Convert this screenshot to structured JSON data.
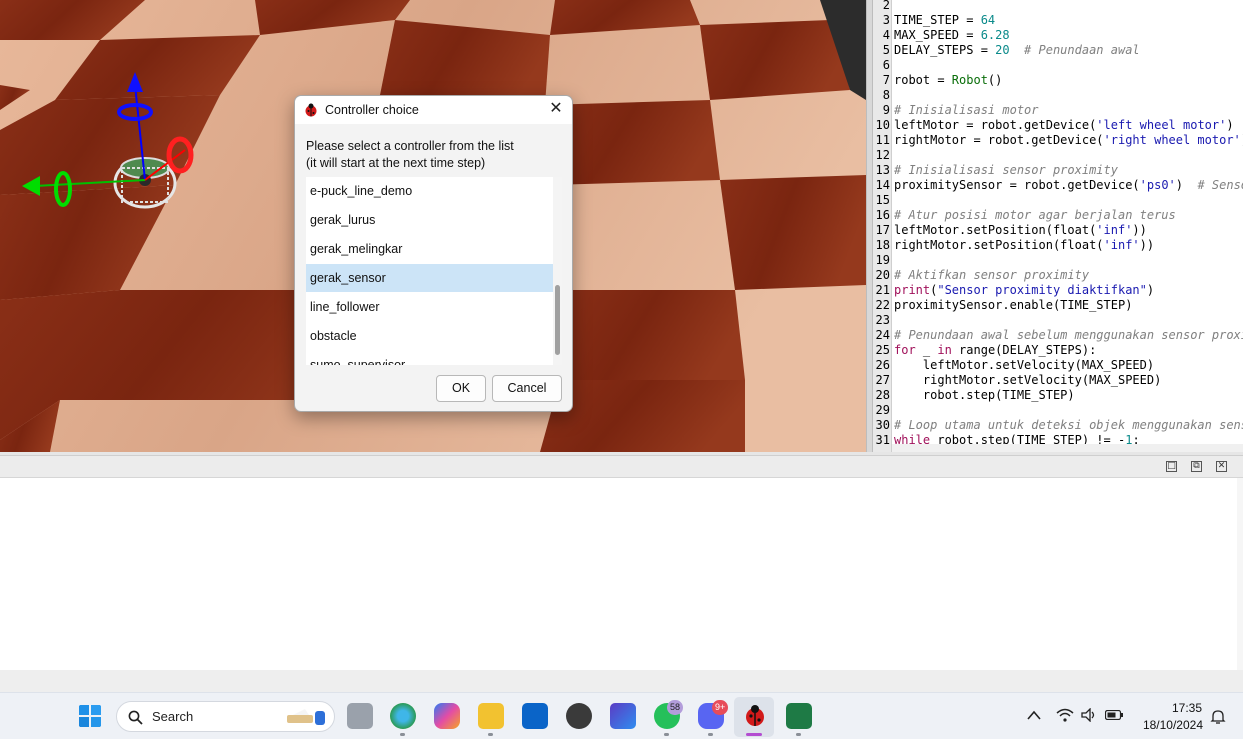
{
  "dialog": {
    "title": "Controller choice",
    "message_line1": "Please select a controller from the list",
    "message_line2": "(it will start at the next time step)",
    "items": [
      "e-puck_line_demo",
      "gerak_lurus",
      "gerak_melingkar",
      "gerak_sensor",
      "line_follower",
      "obstacle",
      "sumo_supervisor"
    ],
    "selected": "gerak_sensor",
    "ok_label": "OK",
    "cancel_label": "Cancel",
    "close_glyph": "✕"
  },
  "editor": {
    "lines": [
      {
        "n": "2",
        "segs": []
      },
      {
        "n": "3",
        "segs": [
          {
            "t": "TIME_STEP = ",
            "c": ""
          },
          {
            "t": "64",
            "c": "num"
          }
        ]
      },
      {
        "n": "4",
        "segs": [
          {
            "t": "MAX_SPEED = ",
            "c": ""
          },
          {
            "t": "6.28",
            "c": "num"
          }
        ]
      },
      {
        "n": "5",
        "segs": [
          {
            "t": "DELAY_STEPS = ",
            "c": ""
          },
          {
            "t": "20",
            "c": "num"
          },
          {
            "t": "  # Penundaan awal",
            "c": "cm"
          }
        ]
      },
      {
        "n": "6",
        "segs": []
      },
      {
        "n": "7",
        "segs": [
          {
            "t": "robot = ",
            "c": ""
          },
          {
            "t": "Robot",
            "c": "fn"
          },
          {
            "t": "()",
            "c": ""
          }
        ]
      },
      {
        "n": "8",
        "segs": []
      },
      {
        "n": "9",
        "segs": [
          {
            "t": "# Inisialisasi motor",
            "c": "cm"
          }
        ]
      },
      {
        "n": "10",
        "segs": [
          {
            "t": "leftMotor = robot.getDevice(",
            "c": ""
          },
          {
            "t": "'left wheel motor'",
            "c": "str"
          },
          {
            "t": ")",
            "c": ""
          }
        ]
      },
      {
        "n": "11",
        "segs": [
          {
            "t": "rightMotor = robot.getDevice(",
            "c": ""
          },
          {
            "t": "'right wheel motor'",
            "c": "str"
          },
          {
            "t": ")",
            "c": ""
          }
        ]
      },
      {
        "n": "12",
        "segs": []
      },
      {
        "n": "13",
        "segs": [
          {
            "t": "# Inisialisasi sensor proximity",
            "c": "cm"
          }
        ]
      },
      {
        "n": "14",
        "segs": [
          {
            "t": "proximitySensor = robot.getDevice(",
            "c": ""
          },
          {
            "t": "'ps0'",
            "c": "str"
          },
          {
            "t": ")  ",
            "c": ""
          },
          {
            "t": "# Senso",
            "c": "cm"
          }
        ]
      },
      {
        "n": "15",
        "segs": []
      },
      {
        "n": "16",
        "segs": [
          {
            "t": "# Atur posisi motor agar berjalan terus",
            "c": "cm"
          }
        ]
      },
      {
        "n": "17",
        "segs": [
          {
            "t": "leftMotor.setPosition(float(",
            "c": ""
          },
          {
            "t": "'inf'",
            "c": "str"
          },
          {
            "t": "))",
            "c": ""
          }
        ]
      },
      {
        "n": "18",
        "segs": [
          {
            "t": "rightMotor.setPosition(float(",
            "c": ""
          },
          {
            "t": "'inf'",
            "c": "str"
          },
          {
            "t": "))",
            "c": ""
          }
        ]
      },
      {
        "n": "19",
        "segs": []
      },
      {
        "n": "20",
        "segs": [
          {
            "t": "# Aktifkan sensor proximity",
            "c": "cm"
          }
        ]
      },
      {
        "n": "21",
        "segs": [
          {
            "t": "print",
            "c": "kw"
          },
          {
            "t": "(",
            "c": ""
          },
          {
            "t": "\"Sensor proximity diaktifkan\"",
            "c": "str"
          },
          {
            "t": ")",
            "c": ""
          }
        ]
      },
      {
        "n": "22",
        "segs": [
          {
            "t": "proximitySensor.enable(TIME_STEP)",
            "c": ""
          }
        ]
      },
      {
        "n": "23",
        "segs": []
      },
      {
        "n": "24",
        "segs": [
          {
            "t": "# Penundaan awal sebelum menggunakan sensor proxi",
            "c": "cm"
          }
        ]
      },
      {
        "n": "25",
        "segs": [
          {
            "t": "for",
            "c": "kw"
          },
          {
            "t": " _ ",
            "c": ""
          },
          {
            "t": "in",
            "c": "kw"
          },
          {
            "t": " range(DELAY_STEPS):",
            "c": ""
          }
        ]
      },
      {
        "n": "26",
        "segs": [
          {
            "t": "    leftMotor.setVelocity(MAX_SPEED)",
            "c": ""
          }
        ]
      },
      {
        "n": "27",
        "segs": [
          {
            "t": "    rightMotor.setVelocity(MAX_SPEED)",
            "c": ""
          }
        ]
      },
      {
        "n": "28",
        "segs": [
          {
            "t": "    robot.step(TIME_STEP)",
            "c": ""
          }
        ]
      },
      {
        "n": "29",
        "segs": []
      },
      {
        "n": "30",
        "segs": [
          {
            "t": "# Loop utama untuk deteksi objek menggunakan sens",
            "c": "cm"
          }
        ]
      },
      {
        "n": "31",
        "segs": [
          {
            "t": "while",
            "c": "kw"
          },
          {
            "t": " robot.step(TIME_STEP) != -",
            "c": ""
          },
          {
            "t": "1",
            "c": "num"
          },
          {
            "t": ":",
            "c": ""
          }
        ]
      }
    ]
  },
  "console": {
    "buttons": [
      "maximize-icon",
      "restore-icon",
      "close-icon"
    ]
  },
  "taskbar": {
    "search_label": "Search",
    "whatsapp_badge": "58",
    "discord_badge": "9+",
    "time": "17:35",
    "date": "18/10/2024",
    "colors": {
      "accent": "#0078d4",
      "taskbar_bg": "#eef1f6"
    }
  }
}
